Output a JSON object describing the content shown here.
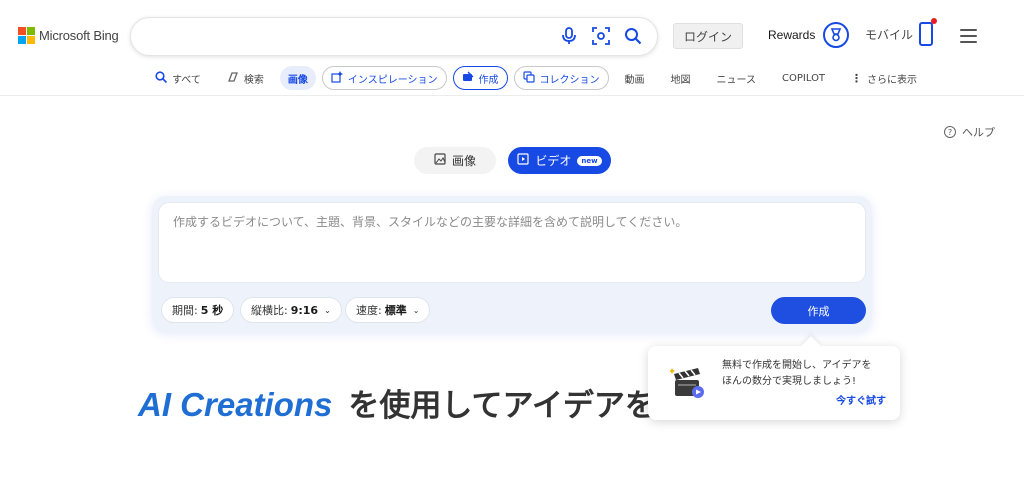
{
  "header": {
    "logo_text": "Microsoft Bing",
    "login_label": "ログイン",
    "rewards_label": "Rewards",
    "mobile_label": "モバイル",
    "search_value": ""
  },
  "nav": {
    "items": [
      {
        "label": "すべて",
        "icon": "search-icon"
      },
      {
        "label": "検索",
        "icon": "copilot-icon"
      },
      {
        "label": "画像",
        "icon": ""
      },
      {
        "label": "インスピレーション",
        "icon": "sparkle-image-icon"
      },
      {
        "label": "作成",
        "icon": "create-icon"
      },
      {
        "label": "コレクション",
        "icon": "collection-icon"
      },
      {
        "label": "動画",
        "icon": ""
      },
      {
        "label": "地図",
        "icon": ""
      },
      {
        "label": "ニュース",
        "icon": ""
      },
      {
        "label": "COPILOT",
        "icon": ""
      },
      {
        "label": "さらに表示",
        "icon": "more-vertical-icon"
      }
    ]
  },
  "help_label": "ヘルプ",
  "toggle": {
    "image_label": "画像",
    "video_label": "ビデオ",
    "new_badge": "new"
  },
  "prompt": {
    "placeholder": "作成するビデオについて、主題、背景、スタイルなどの主要な詳細を含めて説明してください。",
    "duration_label": "期間:",
    "duration_value": "5 秒",
    "aspect_label": "縦横比:",
    "aspect_value": "9:16",
    "speed_label": "速度:",
    "speed_value": "標準",
    "create_label": "作成"
  },
  "headline": {
    "ai_text": "AI Creations",
    "jp_text": "を使用してアイデアを"
  },
  "popup": {
    "line1": "無料で作成を開始し、アイデアを",
    "line2": "ほんの数分で実現しましょう!",
    "link": "今すぐ試す"
  },
  "colors": {
    "accent": "#174ae4",
    "headline_blue": "#1f6ed4",
    "notification": "#e51c23"
  }
}
